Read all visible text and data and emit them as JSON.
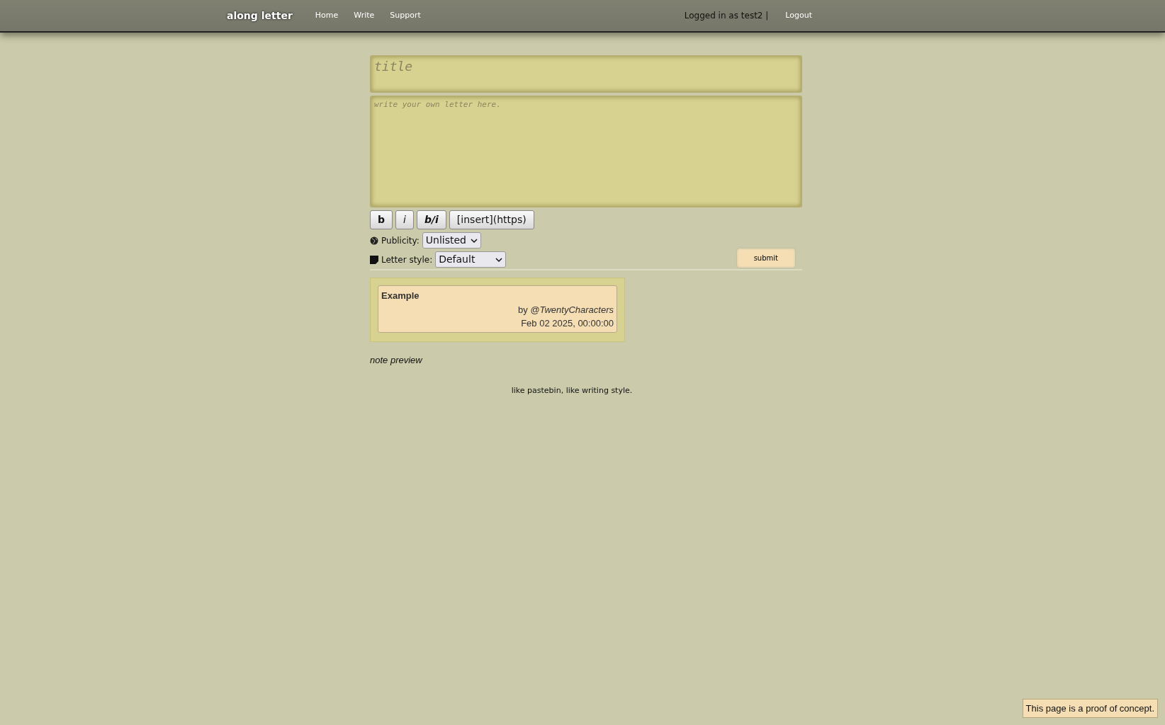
{
  "navbar": {
    "brand": "along letter",
    "links": [
      {
        "label": "Home"
      },
      {
        "label": "Write"
      },
      {
        "label": "Support"
      }
    ],
    "user_text": "Logged in as test2 |",
    "logout": "Logout"
  },
  "editor": {
    "title_placeholder": "title",
    "body_placeholder": "write your own letter here.",
    "format_buttons": [
      {
        "label": "b",
        "kind": "bold"
      },
      {
        "label": "i",
        "kind": "italic"
      },
      {
        "label": "b/i",
        "kind": "bolditalic"
      },
      {
        "label": "[insert](https)",
        "kind": "plain"
      }
    ],
    "publicity": {
      "label": "Publicity:",
      "value": "Unlisted"
    },
    "letter_style": {
      "label": "Letter style:",
      "value": "Default"
    },
    "submit": "submit"
  },
  "preview_card": {
    "title": "Example",
    "author_prefix": "by",
    "author": "@TwentyCharacters",
    "date": "Feb 02 2025, 00:00:00"
  },
  "note_preview": "note preview",
  "footer": "like pastebin, like writing style.",
  "notice": "This page is a proof of concept."
}
